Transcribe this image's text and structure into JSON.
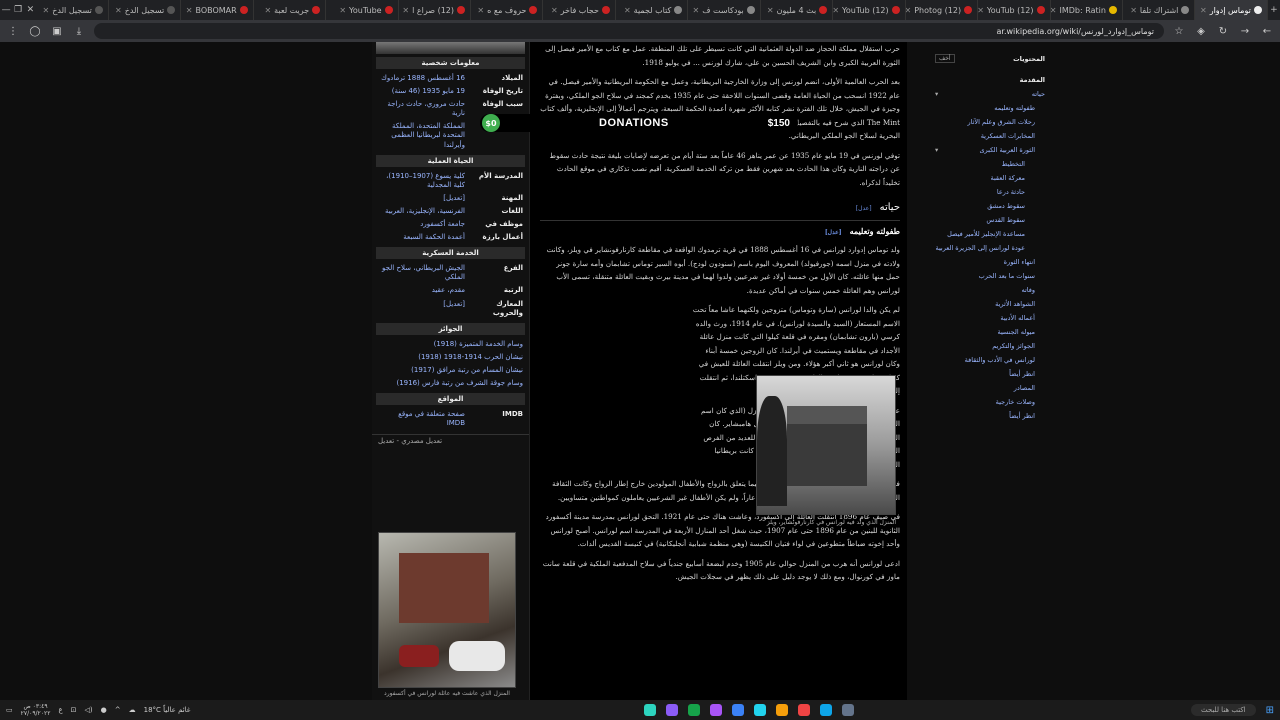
{
  "browser": {
    "tabs": [
      {
        "label": "تسجيل الدخ",
        "color": "#555"
      },
      {
        "label": "تسجيل الدخ",
        "color": "#555"
      },
      {
        "label": "BOBOMAR",
        "color": "#c22"
      },
      {
        "label": "جريت لعبة",
        "color": "#c22"
      },
      {
        "label": "YouTube",
        "color": "#c22"
      },
      {
        "label": "(12) صراع ا",
        "color": "#c22"
      },
      {
        "label": "حروف مع ه",
        "color": "#c22"
      },
      {
        "label": "حجاب فاخر",
        "color": "#c22"
      },
      {
        "label": "كتاب لجمية",
        "color": "#888"
      },
      {
        "label": "بودكاست ف",
        "color": "#888"
      },
      {
        "label": "بث 4 مليون",
        "color": "#c22"
      },
      {
        "label": "(12) YouTub",
        "color": "#c22"
      },
      {
        "label": "(12) Photog",
        "color": "#c22"
      },
      {
        "label": "(12) YouTub",
        "color": "#c22"
      },
      {
        "label": "IMDb: Ratin",
        "color": "#e6b800"
      },
      {
        "label": "اشتراك تلفا",
        "color": "#888"
      },
      {
        "label": "توماس إدوار",
        "color": "#eee",
        "active": true
      }
    ],
    "url": "ar.wikipedia.org/wiki/توماس_إدوارد_لورنس"
  },
  "donation": {
    "zero": "$0",
    "label": "DONATIONS",
    "amount": "$150"
  },
  "infobox": {
    "header_personal": "معلومات شخصية",
    "rows": [
      {
        "k": "الميلاد",
        "v": "16 أغسطس 1888 ترمادوك"
      },
      {
        "k": "تاريخ الوفاة",
        "v": "19 مايو 1935 (46 سنة)"
      },
      {
        "k": "سبب الوفاة",
        "v": "حادث مروري، حادث دراجة نارية"
      },
      {
        "k": "مواطنة",
        "v": "المملكة المتحدة، المملكة المتحدة لبريطانيا العظمى وأيرلندا"
      }
    ],
    "header_life": "الحياة العملية",
    "rows2": [
      {
        "k": "المدرسة الأم",
        "v": "كلية يسوع (1907–1910)، كلية المجدلية"
      },
      {
        "k": "المهنة",
        "v": "[تعديل]"
      },
      {
        "k": "اللغات",
        "v": "الفرنسية، الإنجليزية، العربية"
      },
      {
        "k": "موظف في",
        "v": "جامعة أكسفورد"
      },
      {
        "k": "أعمال بارزة",
        "v": "أعمدة الحكمة السبعة"
      }
    ],
    "header_mil": "الخدمة العسكرية",
    "rows3": [
      {
        "k": "الفرع",
        "v": "الجيش البريطاني، سلاح الجو الملكي"
      },
      {
        "k": "الرتبة",
        "v": "مقدم، عقيد"
      },
      {
        "k": "المعارك والحروب",
        "v": "[تعديل]"
      }
    ],
    "header_awards": "الجوائز",
    "awards": [
      "وسام الخدمة المتميزة (1918)",
      "نيشان الحرب 1914-1918 (1918)",
      "نيشان المسام من رتبة مرافق (1917)",
      "وسام جوقة الشرف من رتبة فارس (1916)"
    ],
    "header_sites": "المواقع",
    "imdb_k": "IMDB",
    "imdb_v": "صفحة متعلقة في موقع IMDB",
    "edit_link": "تعديل مصدري - تعديل",
    "photo_caption": "المنزل الذي عاشت فيه عائلة لورانس في أكسفورد"
  },
  "article": {
    "p1": "حرب استقلال مملكة الحجاز ضد الدولة العثمانية التي كانت تسيطر على تلك المنطقة. عمل مع كتاب مع الأمير فيصل إلى الثورة العربية الكبرى وابن الشريف الحسين بن علي، شارك لورنس ... في يوليو 1918.",
    "p2": "بعد الحرب العالمية الأولى، انضم لورنس إلى وزارة الخارجية البريطانية، وعمل مع الحكومة البريطانية والأمير فيصل. في عام 1922 انسحب من الحياة العامة وقضى السنوات اللاحقة حتى عام 1935 يخدم كمجند في سلاح الجو الملكي، وبفترة وجيزة في الجيش، خلال تلك الفترة نشر كتابه الأكثر شهرة أعمدة الحكمة السبعة، ويترجم أعمالاً إلى الإنجليزية، وألف كتاب The Mint الذي شرح فيه بالتفصيل الوقت الذي قضاه كطيار في سلاح الجو الملكي، كما كتب عن تطوير زوارق الإنقاذ البحرية لسلاح الجو الملكي البريطاني.",
    "p3": "توفي لورنس في 19 مايو عام 1935 عن عمر يناهز 46 عاماً بعد ستة أيام من تعرضه لإصابات بليغة نتيجة حادث سقوط عن دراجته النارية وكان هذا الحادث بعد شهرين فقط من تركه الخدمة العسكرية، أقيم نصب تذكاري في موقع الحادث تخليداً لذكراه.",
    "h2": "حياته",
    "h3": "طفولته وتعليمه",
    "edit": "[عدل]",
    "p4": "ولد توماس إدوارد لورانس في 16 أغسطس 1888 في قرية ترمدوك الواقعة في مقاطعة كارنارفونشاير في ويلز، وكانت ولادته في منزل اسمه (جورفيولد) المعروف اليوم باسم (سنودون لودج). أبوه السير توماس تشابمان وأمه سارة جونر حمل منها عائلته. كان الأول من خمسة أولاد غير شرعيين ولدوا لهما في مدينة بيرث وبقيت العائلة متنقلة، تسمى الأب لورانس وهم العائلة خمس سنوات في أماكن عديدة.",
    "p5": "لم يكن والدا لورانس (سارة وتوماس) متزوجين ولكنهما عاشا معاً تحت الاسم المستعار (السيد والسيدة لورانس). في عام 1914، ورث والده كرسي (بارون تشابمان) ومقره في قلعة كيلوا التي كانت منزل عائلة الأجداد في مقاطعة ويستميث في أيرلندا. كان الزوجين خمسة أبناء وكان لورانس هو ثاني أكبر هؤلاء. ومن ويلز انتقلت العائلة للعيش في كيركودبرايت في منطقة جالواي في جنوب غرب اسكتلندا، ثم انتقلت إلى دينارد في بريتاني ومنها إلى جيرسي.",
    "p6": "عاشت العائلة من عام 1894 إلى 1896 في المنزل (الذي كان اسم الزوج) بلغ في غابة نيو فورست بالقرب من ساحل هامبشاير. كان المسكن معزولاً، وأتيحت الفرصة للشاب لورانس للعديد من الفرص الخارجية في الهواء الطلق وزيارة الواجهة البحرية كانت بريطانيا الفيكتورية.",
    "p7": "في ذلك الوقت كان المجتمع البريطاني محافظاً فيما يتعلق بالزواج والأطفال المولودين خارج إطار الزواج وكانت الثقافة البريطانية الإدواردية تعتبر الأطفال غير الشرعيين عاراً، ولم يكن الأطفال غير الشرعيين يعاملون كمواطنين متساويين.",
    "p8": "في صيف عام 1896 انتقلت العائلة إلى أكسفورد، وعاشت هناك حتى عام 1921. التحق لورانس بمدرسة مدينة أكسفورد الثانوية للبنين من عام 1896 حتى عام 1907، حيث شغل أحد المنازل الأربعة في المدرسة اسم لورانس. أصبح لورانس وأحد إخوته ضباطاً متطوعين في لواء فتيان الكنيسة (وهي منظمة شبابية أنجليكانية) في كنيسة القديس ألدات.",
    "p9": "ادعى لورانس أنه هرب من المنزل حوالي عام 1905 وخدم لبضعة أسابيع جندياً في سلاح المدفعية الملكية في قلعة سانت ماوز في كورنوال، ومع ذلك لا يوجد دليل على ذلك يظهر في سجلات الجيش.",
    "thumb_caption": "المنزل الذي ولد فيه لورانس في كارنارفونشاير، ويلز"
  },
  "toc": {
    "title": "المحتويات",
    "hide": "أخف",
    "items": [
      {
        "label": "المقدمة",
        "level": 0,
        "first": true
      },
      {
        "label": "حياته",
        "level": 0,
        "caret": true
      },
      {
        "label": "طفولته وتعليمه",
        "level": 1
      },
      {
        "label": "رحلات الشرق وعلم الآثار",
        "level": 1
      },
      {
        "label": "المخابرات العسكرية",
        "level": 1
      },
      {
        "label": "الثورة العربية الكبرى",
        "level": 1,
        "caret": true
      },
      {
        "label": "التخطيط",
        "level": 2
      },
      {
        "label": "معركة العقبة",
        "level": 2
      },
      {
        "label": "حادثة درعا",
        "level": 2
      },
      {
        "label": "سقوط دمشق",
        "level": 2
      },
      {
        "label": "سقوط القدس",
        "level": 2
      },
      {
        "label": "مساعدة الإنجليز للأمير فيصل",
        "level": 2
      },
      {
        "label": "عودة لورانس إلى الجزيرة العربية",
        "level": 2
      },
      {
        "label": "انتهاء الثورة",
        "level": 1
      },
      {
        "label": "سنوات ما بعد الحرب",
        "level": 1
      },
      {
        "label": "وفاته",
        "level": 1
      },
      {
        "label": "الشواهد الأثرية",
        "level": 1
      },
      {
        "label": "أعماله الأدبية",
        "level": 1
      },
      {
        "label": "ميوله الجنسية",
        "level": 1
      },
      {
        "label": "الجوائز والتكريم",
        "level": 1
      },
      {
        "label": "لورانس في الأدب والثقافة",
        "level": 1
      },
      {
        "label": "انظر أيضاً",
        "level": 1
      },
      {
        "label": "المصادر",
        "level": 1
      },
      {
        "label": "وصلات خارجية",
        "level": 1
      },
      {
        "label": "انظر أيضاً",
        "level": 1
      }
    ]
  },
  "taskbar": {
    "search_placeholder": "اكتب هنا للبحث",
    "weather": "18°C غائم عالياً",
    "time": "٠٣:٤٩ ص",
    "date": "٢٧/٠٩/٢٠٢٢",
    "app_colors": [
      "#2dd4bf",
      "#8b5cf6",
      "#16a34a",
      "#a855f7",
      "#3b82f6",
      "#22d3ee",
      "#f59e0b",
      "#ef4444",
      "#0ea5e9",
      "#64748b"
    ]
  }
}
